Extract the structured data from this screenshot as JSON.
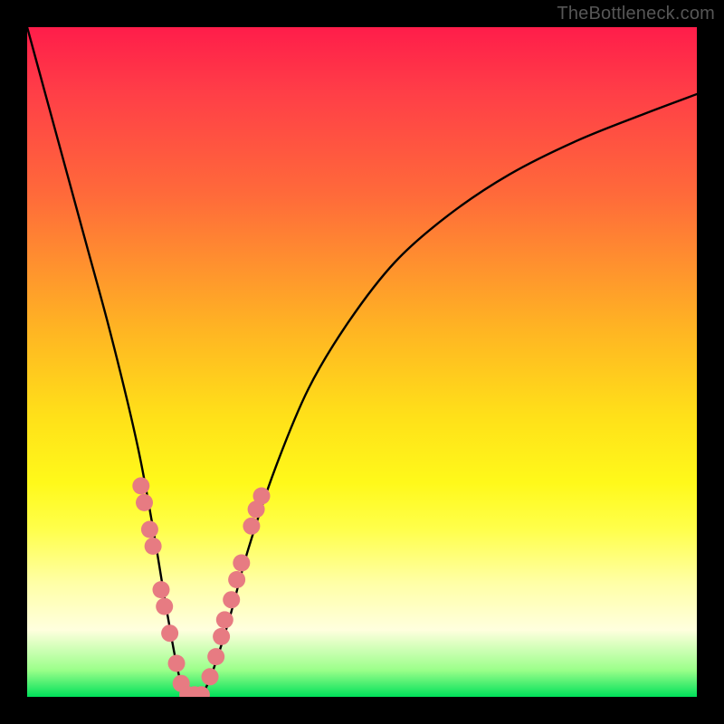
{
  "watermark": "TheBottleneck.com",
  "chart_data": {
    "type": "line",
    "title": "",
    "xlabel": "",
    "ylabel": "",
    "xlim": [
      0,
      100
    ],
    "ylim": [
      0,
      100
    ],
    "grid": false,
    "legend": false,
    "series": [
      {
        "name": "bottleneck-curve",
        "x": [
          0,
          3,
          6,
          9,
          12,
          15,
          17,
          19,
          21,
          23,
          25,
          27,
          30,
          33,
          37,
          42,
          48,
          55,
          63,
          72,
          82,
          92,
          100
        ],
        "y": [
          100,
          89,
          78,
          67,
          56,
          44,
          35,
          24,
          12,
          2,
          0,
          2,
          11,
          22,
          34,
          46,
          56,
          65,
          72,
          78,
          83,
          87,
          90
        ]
      }
    ],
    "markers": [
      {
        "name": "bead-cluster-left",
        "color": "#e77b82",
        "points": [
          {
            "x": 17.0,
            "y": 31.5
          },
          {
            "x": 17.5,
            "y": 29.0
          },
          {
            "x": 18.3,
            "y": 25.0
          },
          {
            "x": 18.8,
            "y": 22.5
          },
          {
            "x": 20.0,
            "y": 16.0
          },
          {
            "x": 20.5,
            "y": 13.5
          },
          {
            "x": 21.3,
            "y": 9.5
          },
          {
            "x": 22.3,
            "y": 5.0
          },
          {
            "x": 23.0,
            "y": 2.0
          }
        ]
      },
      {
        "name": "bead-cluster-bottom",
        "color": "#e77b82",
        "points": [
          {
            "x": 24.0,
            "y": 0.3
          },
          {
            "x": 25.0,
            "y": 0.3
          },
          {
            "x": 26.0,
            "y": 0.3
          }
        ]
      },
      {
        "name": "bead-cluster-right",
        "color": "#e77b82",
        "points": [
          {
            "x": 27.3,
            "y": 3.0
          },
          {
            "x": 28.2,
            "y": 6.0
          },
          {
            "x": 29.0,
            "y": 9.0
          },
          {
            "x": 29.5,
            "y": 11.5
          },
          {
            "x": 30.5,
            "y": 14.5
          },
          {
            "x": 31.3,
            "y": 17.5
          },
          {
            "x": 32.0,
            "y": 20.0
          },
          {
            "x": 33.5,
            "y": 25.5
          },
          {
            "x": 34.2,
            "y": 28.0
          },
          {
            "x": 35.0,
            "y": 30.0
          }
        ]
      }
    ],
    "background": {
      "type": "vertical-gradient",
      "stops": [
        {
          "pos": 0.0,
          "color": "#ff1d4a"
        },
        {
          "pos": 0.68,
          "color": "#fff91a"
        },
        {
          "pos": 0.96,
          "color": "#9bff8a"
        },
        {
          "pos": 1.0,
          "color": "#00e05a"
        }
      ]
    }
  }
}
